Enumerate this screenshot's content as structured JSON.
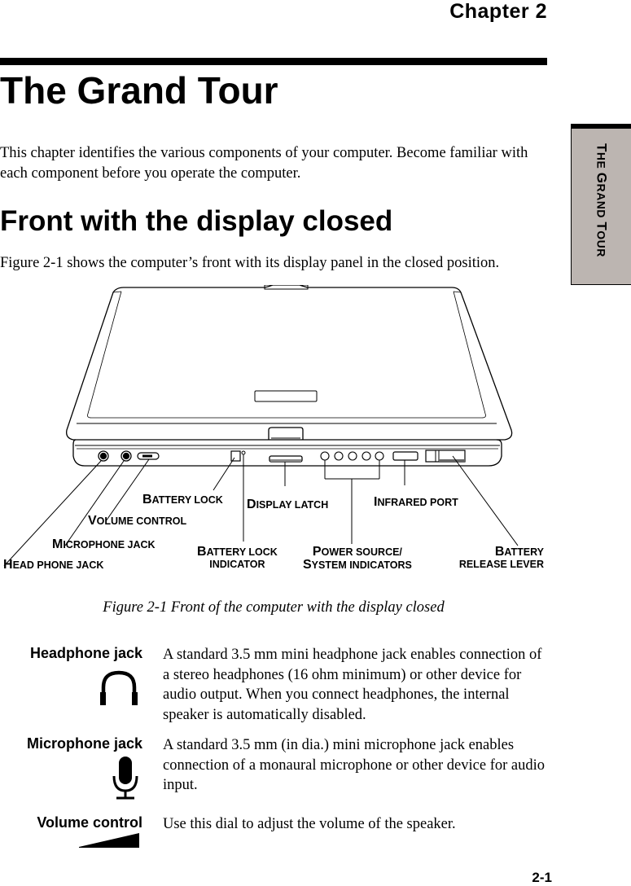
{
  "header": {
    "chapter_label": "Chapter  2",
    "title": "The Grand Tour"
  },
  "side_tab": {
    "parts": [
      {
        "big": "T",
        "small": "HE "
      },
      {
        "big": "G",
        "small": "RAND "
      },
      {
        "big": "T",
        "small": "OUR"
      }
    ]
  },
  "intro": "This chapter identifies the various components of your computer. Become familiar with each component before you operate the computer.",
  "section": {
    "heading": "Front with the display closed",
    "lead": "Figure 2-1 shows the computer’s front with its display panel in the closed position."
  },
  "figure": {
    "labels": {
      "battery_lock": {
        "cap": "B",
        "rest": "ATTERY LOCK"
      },
      "display_latch": {
        "cap": "D",
        "rest": "ISPLAY LATCH"
      },
      "infrared_port": {
        "cap": "I",
        "rest": "NFRARED PORT"
      },
      "volume_control": {
        "cap": "V",
        "rest": "OLUME CONTROL"
      },
      "microphone_jack": {
        "cap": "M",
        "rest": "ICROPHONE JACK"
      },
      "head_phone_jack": {
        "cap": "H",
        "rest": "EAD PHONE JACK"
      },
      "battery_lock_indicator": {
        "cap": "B",
        "rest": "ATTERY LOCK",
        "line2": "INDICATOR"
      },
      "power_source": {
        "cap": "P",
        "rest": "OWER SOURCE/",
        "cap2": "S",
        "rest2": "YSTEM INDICATORS"
      },
      "battery_release": {
        "cap": "B",
        "rest": "ATTERY",
        "line2": "RELEASE LEVER"
      }
    },
    "caption": "Figure 2-1 Front of the computer with the display closed"
  },
  "components": [
    {
      "term": "Headphone jack",
      "icon": "headphones-icon",
      "description": "A standard 3.5 mm mini headphone jack enables connection of a stereo headphones (16 ohm minimum) or other device for audio output. When you connect headphones, the internal speaker is automatically disabled."
    },
    {
      "term": "Microphone jack",
      "icon": "microphone-icon",
      "description": "A standard 3.5 mm (in dia.) mini microphone jack enables connection of a monaural microphone or other device for audio input."
    },
    {
      "term": "Volume control",
      "icon": "volume-wedge-icon",
      "description": "Use this dial to adjust the volume of the speaker."
    }
  ],
  "footer": {
    "page_number": "2-1"
  },
  "colors": {
    "side_tab_bg": "#bcb5b1",
    "text": "#000000"
  }
}
